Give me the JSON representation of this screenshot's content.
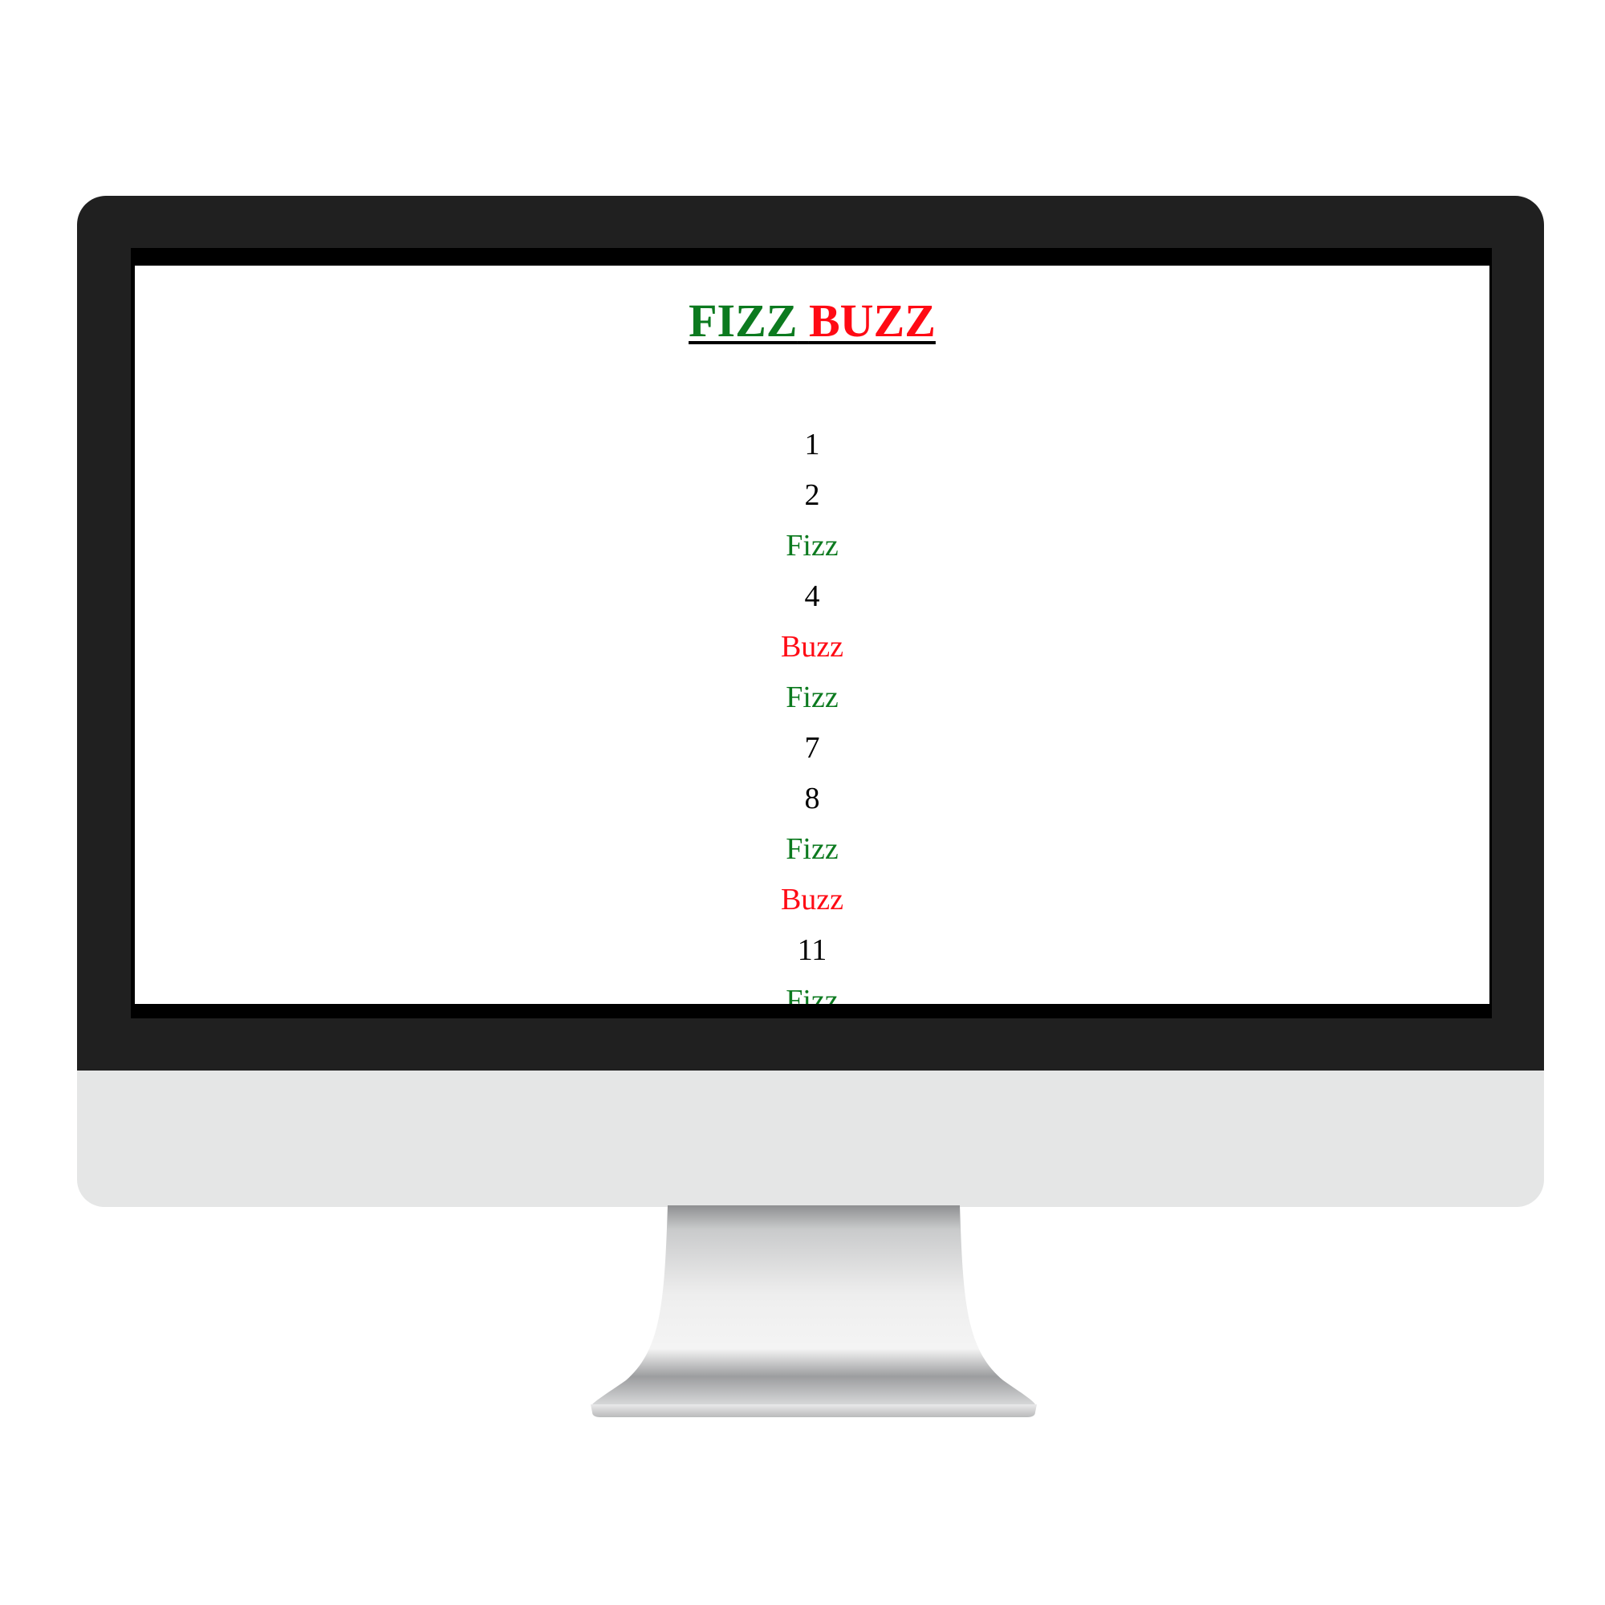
{
  "title": {
    "fizz": "FIZZ",
    "buzz": "BUZZ"
  },
  "items": [
    {
      "text": "1",
      "kind": "number"
    },
    {
      "text": "2",
      "kind": "number"
    },
    {
      "text": "Fizz",
      "kind": "fizz"
    },
    {
      "text": "4",
      "kind": "number"
    },
    {
      "text": "Buzz",
      "kind": "buzz"
    },
    {
      "text": "Fizz",
      "kind": "fizz"
    },
    {
      "text": "7",
      "kind": "number"
    },
    {
      "text": "8",
      "kind": "number"
    },
    {
      "text": "Fizz",
      "kind": "fizz"
    },
    {
      "text": "Buzz",
      "kind": "buzz"
    },
    {
      "text": "11",
      "kind": "number"
    },
    {
      "text": "Fizz",
      "kind": "fizz"
    }
  ],
  "colors": {
    "fizz": "#0c7a1f",
    "buzz": "#ff0a14",
    "number": "#000000",
    "bezel": "#202020",
    "chin": "#e5e6e6"
  }
}
